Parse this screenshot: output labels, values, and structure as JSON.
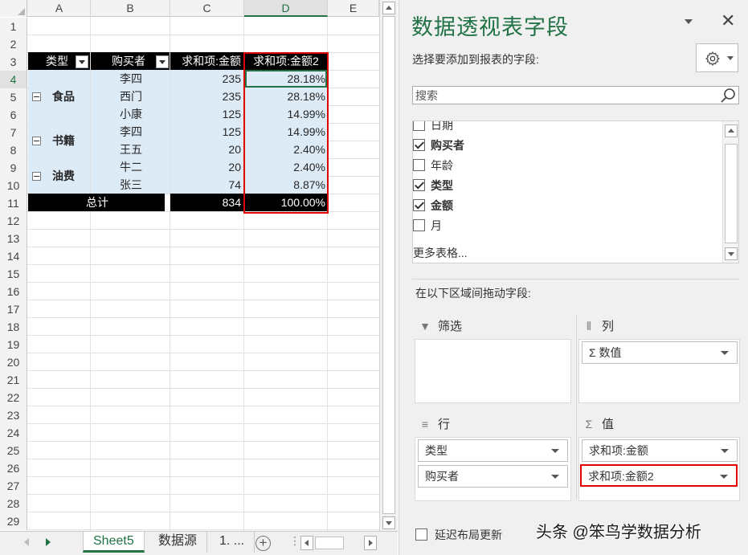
{
  "sheet": {
    "columns": [
      "A",
      "B",
      "C",
      "D",
      "E"
    ],
    "rows": [
      "1",
      "2",
      "3",
      "4",
      "5",
      "6",
      "7",
      "8",
      "9",
      "10",
      "11",
      "12",
      "13",
      "14",
      "15",
      "16",
      "17",
      "18",
      "19",
      "20",
      "21",
      "22",
      "23",
      "24",
      "25",
      "26",
      "27",
      "28",
      "29"
    ],
    "pivot": {
      "header": {
        "type": "类型",
        "buyer": "购买者",
        "sum_amount": "求和项:金额",
        "sum_amount2": "求和项:金额2"
      },
      "groups": [
        {
          "name": "食品",
          "rows": [
            {
              "buyer": "李四",
              "amount": "235",
              "pct": "28.18%"
            },
            {
              "buyer": "西门",
              "amount": "235",
              "pct": "28.18%"
            },
            {
              "buyer": "小康",
              "amount": "125",
              "pct": "14.99%"
            }
          ]
        },
        {
          "name": "书籍",
          "rows": [
            {
              "buyer": "李四",
              "amount": "125",
              "pct": "14.99%"
            },
            {
              "buyer": "王五",
              "amount": "20",
              "pct": "2.40%"
            }
          ]
        },
        {
          "name": "油费",
          "rows": [
            {
              "buyer": "牛二",
              "amount": "20",
              "pct": "2.40%"
            },
            {
              "buyer": "张三",
              "amount": "74",
              "pct": "8.87%"
            }
          ]
        }
      ],
      "total": {
        "label": "总计",
        "amount": "834",
        "pct": "100.00%"
      }
    },
    "tabs": {
      "active": "Sheet5",
      "second": "数据源",
      "third": "1. ..."
    },
    "add_sheet": "+"
  },
  "pane": {
    "title": "数据透视表字段",
    "close": "✕",
    "subtitle": "选择要添加到报表的字段:",
    "search_placeholder": "搜索",
    "fields": [
      {
        "label": "日期",
        "checked": false
      },
      {
        "label": "购买者",
        "checked": true
      },
      {
        "label": "年龄",
        "checked": false
      },
      {
        "label": "类型",
        "checked": true
      },
      {
        "label": "金额",
        "checked": true
      },
      {
        "label": "月",
        "checked": false
      }
    ],
    "more_tables": "更多表格...",
    "drag_label": "在以下区域间拖动字段:",
    "areas": {
      "filter": {
        "title": "筛选"
      },
      "columns": {
        "title": "列",
        "items": [
          "Σ 数值"
        ]
      },
      "rows": {
        "title": "行",
        "items": [
          "类型",
          "购买者"
        ]
      },
      "values": {
        "title": "值",
        "items": [
          "求和项:金额",
          "求和项:金额2"
        ]
      }
    },
    "defer_label": "延迟布局更新"
  },
  "watermark": "头条 @笨鸟学数据分析",
  "colors": {
    "accent": "#217346",
    "highlight": "#e00000",
    "pivot_row": "#ddebf7"
  }
}
